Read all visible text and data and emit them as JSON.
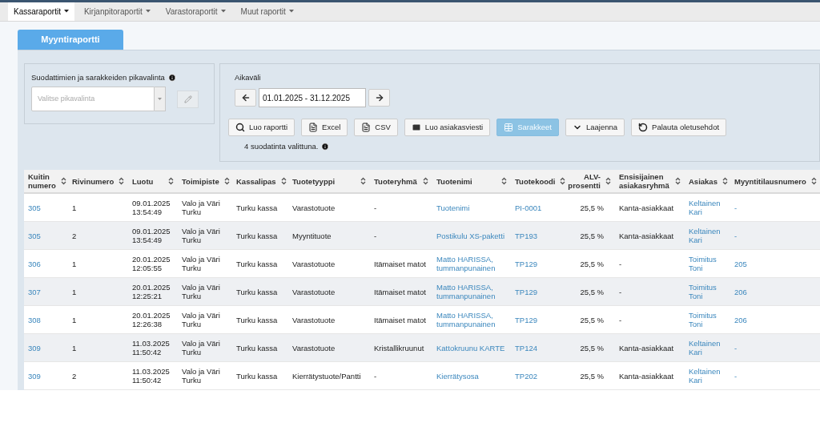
{
  "menu": [
    {
      "label": "Kassaraportit",
      "selected": true
    },
    {
      "label": "Kirjanpitoraportit",
      "selected": false
    },
    {
      "label": "Varastoraportit",
      "selected": false
    },
    {
      "label": "Muut raportit",
      "selected": false
    }
  ],
  "report_tab": {
    "label": "Myyntiraportti",
    "selected": true
  },
  "quick_select": {
    "label": "Suodattimien ja sarakkeiden pikavalinta",
    "placeholder": "Valitse pikavalinta"
  },
  "date_range": {
    "label": "Aikaväli",
    "value": "01.01.2025 - 31.12.2025"
  },
  "actions": [
    {
      "label": "Luo raportti",
      "kind": "search",
      "disabled": false
    },
    {
      "label": "Excel",
      "kind": "file",
      "disabled": false
    },
    {
      "label": "CSV",
      "kind": "file",
      "disabled": false
    },
    {
      "label": "Luo asiakasviesti",
      "kind": "mail",
      "disabled": false
    },
    {
      "label": "Sarakkeet",
      "kind": "table",
      "disabled": true
    },
    {
      "label": "Laajenna",
      "kind": "expand",
      "disabled": false
    },
    {
      "label": "Palauta oletusehdot",
      "kind": "reset",
      "disabled": false
    }
  ],
  "filter_note": "4 suodatinta valittuna.",
  "table": {
    "columns": [
      {
        "label": "Kuitin numero",
        "kind": "link"
      },
      {
        "label": "Rivinumero",
        "kind": "text"
      },
      {
        "label": "Luotu",
        "kind": "text"
      },
      {
        "label": "Toimipiste",
        "kind": "text"
      },
      {
        "label": "Kassalipas",
        "kind": "text"
      },
      {
        "label": "Tuotetyyppi",
        "kind": "text"
      },
      {
        "label": "Tuoteryhmä",
        "kind": "text"
      },
      {
        "label": "Tuotenimi",
        "kind": "link"
      },
      {
        "label": "Tuotekoodi",
        "kind": "link"
      },
      {
        "label": "ALV-prosentti",
        "kind": "number"
      },
      {
        "label": "Ensisijainen asiakasryhmä",
        "kind": "text"
      },
      {
        "label": "Asiakas",
        "kind": "link"
      },
      {
        "label": "Myyntitilausnumero",
        "kind": "link"
      }
    ],
    "rows": [
      [
        "305",
        "1",
        "09.01.2025 13:54:49",
        "Valo ja Väri Turku",
        "Turku kassa",
        "Varastotuote",
        "-",
        "Tuotenimi",
        "PI-0001",
        "25,5 %",
        "Kanta-asiakkaat",
        "Keltainen Kari",
        "-"
      ],
      [
        "305",
        "2",
        "09.01.2025 13:54:49",
        "Valo ja Väri Turku",
        "Turku kassa",
        "Myyntituote",
        "-",
        "Postikulu XS-paketti",
        "TP193",
        "25,5 %",
        "Kanta-asiakkaat",
        "Keltainen Kari",
        "-"
      ],
      [
        "306",
        "1",
        "20.01.2025 12:05:55",
        "Valo ja Väri Turku",
        "Turku kassa",
        "Varastotuote",
        "Itämaiset matot",
        "Matto HARISSA, tummanpunainen",
        "TP129",
        "25,5 %",
        "-",
        "Toimitus Toni",
        "205"
      ],
      [
        "307",
        "1",
        "20.01.2025 12:25:21",
        "Valo ja Väri Turku",
        "Turku kassa",
        "Varastotuote",
        "Itämaiset matot",
        "Matto HARISSA, tummanpunainen",
        "TP129",
        "25,5 %",
        "-",
        "Toimitus Toni",
        "206"
      ],
      [
        "308",
        "1",
        "20.01.2025 12:26:38",
        "Valo ja Väri Turku",
        "Turku kassa",
        "Varastotuote",
        "Itämaiset matot",
        "Matto HARISSA, tummanpunainen",
        "TP129",
        "25,5 %",
        "-",
        "Toimitus Toni",
        "206"
      ],
      [
        "309",
        "1",
        "11.03.2025 11:50:42",
        "Valo ja Väri Turku",
        "Turku kassa",
        "Varastotuote",
        "Kristallikruunut",
        "Kattokruunu KARTE",
        "TP124",
        "25,5 %",
        "Kanta-asiakkaat",
        "Keltainen Kari",
        "-"
      ],
      [
        "309",
        "2",
        "11.03.2025 11:50:42",
        "Valo ja Väri Turku",
        "Turku kassa",
        "Kierrätystuote/Pantti",
        "-",
        "Kierrätysosa",
        "TP202",
        "25,5 %",
        "Kanta-asiakkaat",
        "Keltainen Kari",
        "-"
      ]
    ]
  }
}
